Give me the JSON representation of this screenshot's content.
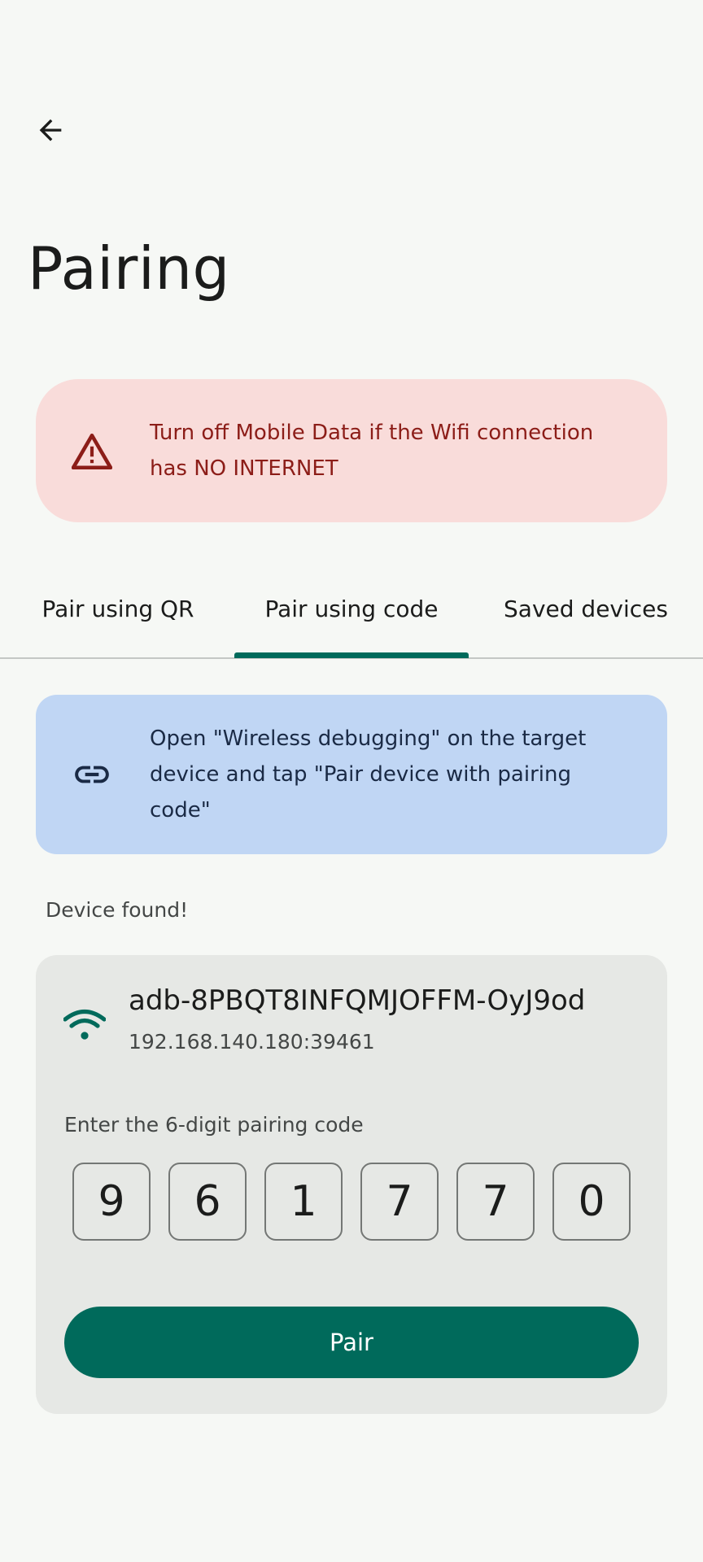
{
  "colors": {
    "background": "#f6f8f5",
    "accent": "#006a5b",
    "warning_bg": "#f9dcda",
    "warning_text": "#8c1d18",
    "info_bg": "#c0d6f4",
    "card_bg": "#e6e8e5"
  },
  "header": {
    "back_icon": "arrow-back-icon",
    "title": "Pairing"
  },
  "warning": {
    "icon": "warning-triangle-icon",
    "text": "Turn off Mobile Data if the Wifi connection has NO INTERNET"
  },
  "tabs": [
    {
      "label": "Pair using QR",
      "selected": false
    },
    {
      "label": "Pair using code",
      "selected": true
    },
    {
      "label": "Saved devices",
      "selected": false
    }
  ],
  "info": {
    "icon": "link-icon",
    "text": "Open \"Wireless debugging\" on the target device and tap \"Pair device with pairing code\""
  },
  "status": "Device found!",
  "device": {
    "icon": "wifi-icon",
    "name": "adb-8PBQT8INFQMJOFFM-OyJ9od",
    "address": "192.168.140.180:39461"
  },
  "pairing": {
    "label": "Enter the 6-digit pairing code",
    "digits": [
      "9",
      "6",
      "1",
      "7",
      "7",
      "0"
    ],
    "button_label": "Pair"
  }
}
